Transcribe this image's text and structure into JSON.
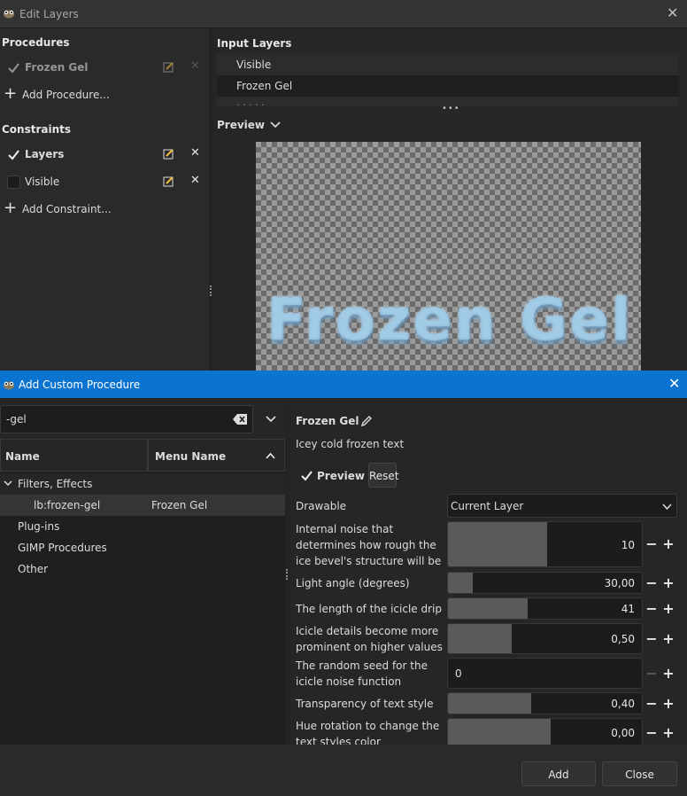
{
  "edit_layers": {
    "title": "Edit Layers",
    "procedures_header": "Procedures",
    "procedures": [
      {
        "label": "Frozen Gel",
        "checked": true
      }
    ],
    "add_procedure": "Add Procedure...",
    "constraints_header": "Constraints",
    "constraints": [
      {
        "label": "Layers",
        "checked": true
      },
      {
        "label": "Visible",
        "checked": false
      }
    ],
    "add_constraint": "Add Constraint...",
    "input_layers_header": "Input Layers",
    "input_layers": [
      "Visible",
      "Frozen Gel"
    ],
    "preview_header": "Preview",
    "preview_text": "Frozen Gel"
  },
  "dialog": {
    "title": "Add Custom Procedure",
    "search_value": "-gel",
    "columns": {
      "name": "Name",
      "menu_name": "Menu Name"
    },
    "tree": [
      {
        "label": "Filters, Effects",
        "expanded": true
      },
      {
        "label": "lb:frozen-gel",
        "menu": "Frozen Gel"
      },
      {
        "label": "Plug-ins"
      },
      {
        "label": "GIMP Procedures"
      },
      {
        "label": "Other"
      }
    ],
    "proc_name": "Frozen Gel",
    "proc_desc": "Icey cold frozen text",
    "preview_label": "Preview",
    "reset_label": "Reset",
    "drawable_label": "Drawable",
    "drawable_value": "Current Layer",
    "params": [
      {
        "label": "Internal noise that determines how rough the ice bevel's structure will be",
        "value": "10",
        "fraction": 0.51
      },
      {
        "label": "Light angle (degrees)",
        "value": "30,00",
        "fraction": 0.13
      },
      {
        "label": "The length of the icicle drip",
        "value": "41",
        "fraction": 0.41
      },
      {
        "label": "Icicle details become more prominent on higher values",
        "value": "0,50",
        "fraction": 0.33
      },
      {
        "label": "The random seed for the icicle noise function",
        "value": "0",
        "fraction": 0.0
      },
      {
        "label": "Transparency of text style",
        "value": "0,40",
        "fraction": 0.43
      },
      {
        "label": "Hue rotation to change the text styles color",
        "value": "0,00",
        "fraction": 0.53
      }
    ],
    "add_button": "Add",
    "close_button": "Close"
  },
  "colors": {
    "accent": "#0b73d0",
    "background": "#262626"
  }
}
